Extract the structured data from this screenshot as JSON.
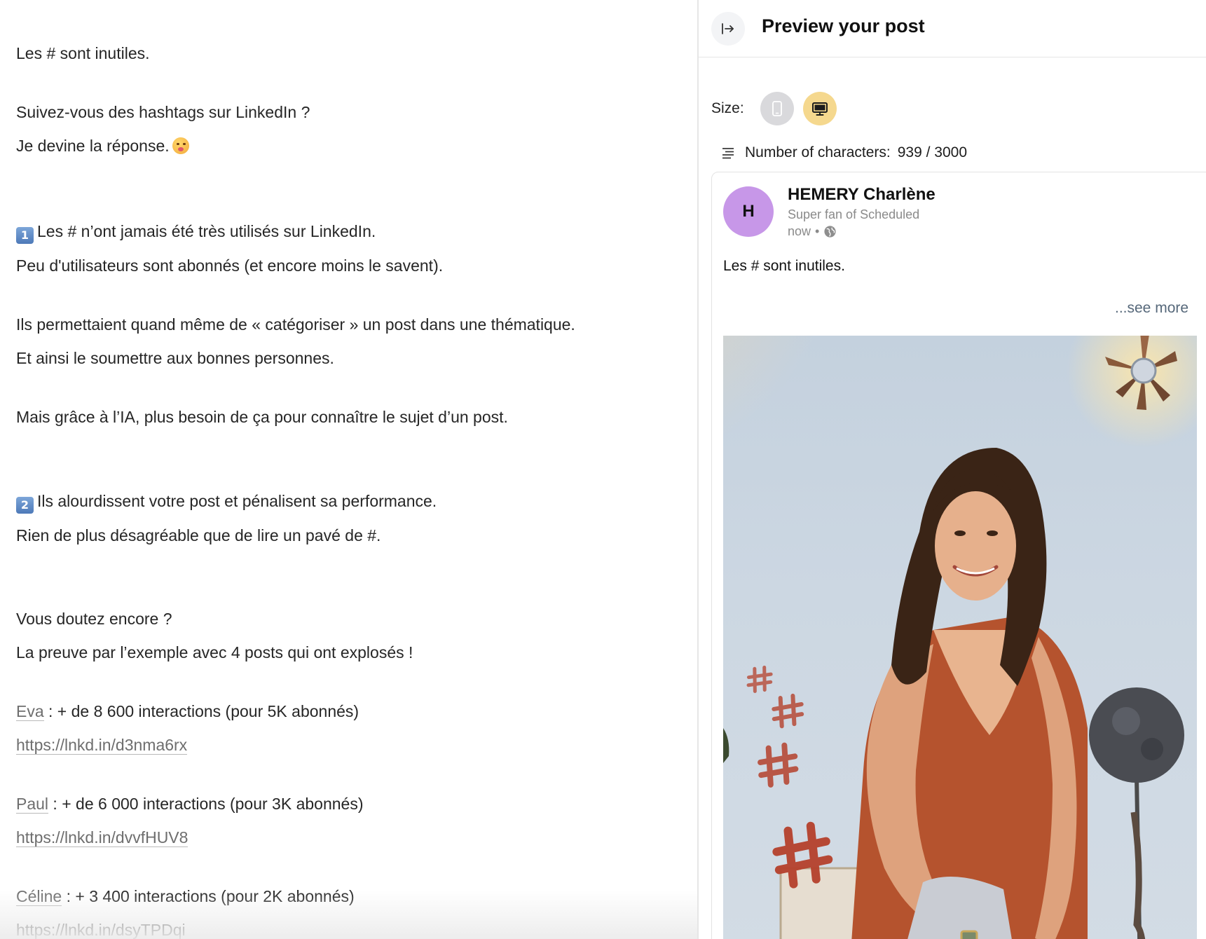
{
  "editor": {
    "l1": "Les # sont inutiles.",
    "l2": "Suivez-vous des hashtags sur LinkedIn ?",
    "l3": "Je devine la réponse.",
    "k1": "1",
    "l4": "Les # n’ont jamais été très utilisés sur LinkedIn.",
    "l5": "Peu d'utilisateurs sont abonnés (et encore moins le savent).",
    "l6": "Ils permettaient quand même de « catégoriser » un post dans une thématique.",
    "l7": "Et ainsi le soumettre aux bonnes personnes.",
    "l8": "Mais grâce à l’IA, plus besoin de ça pour connaître le sujet d’un post.",
    "k2": "2",
    "l9": "Ils alourdissent votre post et pénalisent sa performance.",
    "l10": "Rien de plus désagréable que de lire un pavé de #.",
    "l11": "Vous doutez encore ?",
    "l12": "La preuve par l’exemple avec 4 posts qui ont explosés !",
    "m1": "Eva",
    "m1_text": " : + de 8 600 interactions (pour 5K abonnés)",
    "url1": "https://lnkd.in/d3nma6rx",
    "m2": "Paul",
    "m2_text": " : + de 6 000 interactions (pour 3K abonnés)",
    "url2": "https://lnkd.in/dvvfHUV8",
    "m3": "Céline",
    "m3_text": " : + 3 400 interactions (pour 2K abonnés)",
    "url3": "https://lnkd.in/dsyTPDqi"
  },
  "preview": {
    "title": "Preview your post",
    "size_label": "Size:",
    "chars_label": "Number of characters:",
    "chars_count": "939 / 3000",
    "author_initial": "H",
    "author_name": "HEMERY Charlène",
    "author_tagline": "Super fan of Scheduled",
    "timestamp": "now",
    "meta_sep": "•",
    "post_text": "Les # sont inutiles.",
    "see_more": "...see more"
  },
  "colors": {
    "avatar_bg": "#c797e8",
    "desktop_active": "#f5d88e",
    "mobile_inactive": "#d9d9dc",
    "see_more": "#56687a"
  },
  "icons": {
    "collapse": "collapse-panel-icon",
    "mobile": "mobile-device-icon",
    "desktop": "desktop-monitor-icon",
    "chars": "text-lines-icon",
    "visibility": "globe-icon"
  }
}
